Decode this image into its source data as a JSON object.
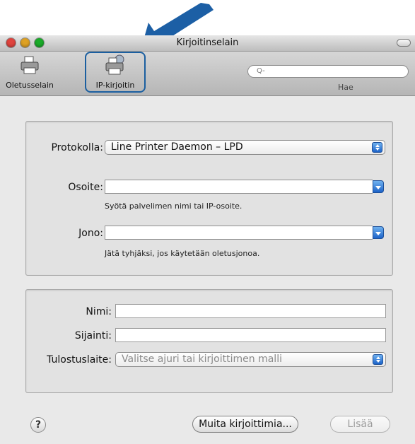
{
  "window": {
    "title": "Kirjoitinselain"
  },
  "toolbar": {
    "default_label": "Oletusselain",
    "ip_label": "IP-kirjoitin",
    "search_placeholder": "Q-",
    "search_label": "Hae"
  },
  "connection": {
    "protocol_label": "Protokolla:",
    "protocol_value": "Line Printer Daemon – LPD",
    "address_label": "Osoite:",
    "address_value": "",
    "address_hint": "Syötä palvelimen nimi tai IP-osoite.",
    "queue_label": "Jono:",
    "queue_value": "",
    "queue_hint": "Jätä tyhjäksi, jos käytetään oletusjonoa."
  },
  "printer": {
    "name_label": "Nimi:",
    "name_value": "",
    "location_label": "Sijainti:",
    "location_value": "",
    "printwith_label": "Tulostuslaite:",
    "printwith_value": "Valitse ajuri tai kirjoittimen malli"
  },
  "footer": {
    "help_label": "?",
    "more_printers_label": "Muita kirjoittimia...",
    "add_label": "Lisää"
  },
  "colors": {
    "arrow": "#1c5fa5",
    "highlight": "#1b5fa0",
    "stepper": "#2a6fd0"
  }
}
